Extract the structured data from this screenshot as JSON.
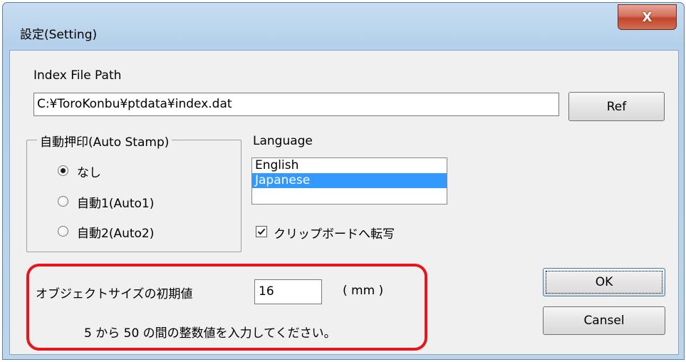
{
  "window": {
    "title": "設定(Setting)",
    "close_label": "X"
  },
  "index_file": {
    "label": "Index File Path",
    "value": "C:¥ToroKonbu¥ptdata¥index.dat",
    "ref_button": "Ref"
  },
  "auto_stamp": {
    "caption": "自動押印(Auto Stamp)",
    "options": [
      {
        "label": "なし",
        "checked": true
      },
      {
        "label": "自動1(Auto1)",
        "checked": false
      },
      {
        "label": "自動2(Auto2)",
        "checked": false
      }
    ]
  },
  "language": {
    "label": "Language",
    "items": [
      "English",
      "Japanese"
    ],
    "selected": "Japanese"
  },
  "clipboard": {
    "label": "クリップボードへ転写",
    "checked": true
  },
  "object_size": {
    "label": "オブジェクトサイズの初期値",
    "value": "16",
    "unit": "( mm )",
    "hint": "5 から 50 の間の整数値を入力してください。"
  },
  "buttons": {
    "ok": "OK",
    "cancel": "Cansel"
  },
  "colors": {
    "selection": "#3399ff",
    "highlight_border": "#e8141e"
  }
}
